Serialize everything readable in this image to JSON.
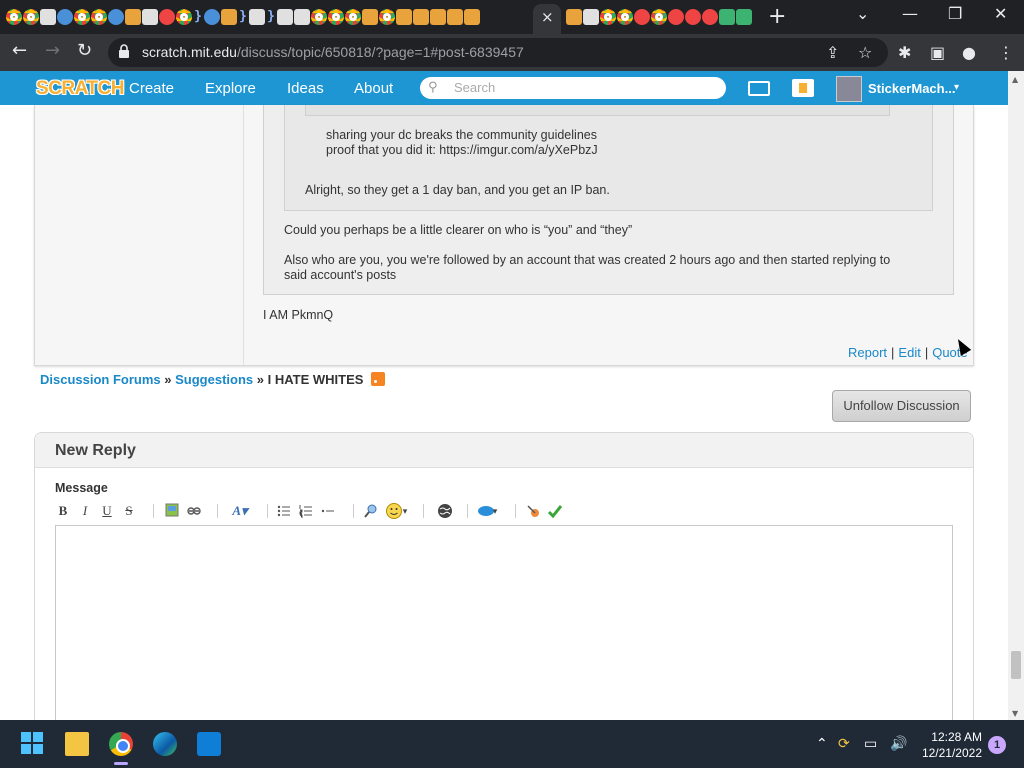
{
  "browser": {
    "active_tab_close": "×",
    "new_tab": "+",
    "window_controls": {
      "tabsearch": "⌄",
      "minimize": "—",
      "restore": "❐",
      "close": "✕"
    },
    "url_host": "scratch.mit.edu",
    "url_path": "/discuss/topic/650818/?page=1#post-6839457",
    "nav": {
      "back": "←",
      "forward": "→",
      "reload": "↻"
    },
    "toolbar_icons": {
      "share": "⇪",
      "bookmark": "☆",
      "extensions": "✱",
      "sidepanel": "▣",
      "profile": "●",
      "menu": "⋮"
    }
  },
  "scratch_nav": {
    "logo": "SCRATCH",
    "links": [
      "Create",
      "Explore",
      "Ideas",
      "About"
    ],
    "search_placeholder": "Search",
    "username": "StickerMach...",
    "caret": "▾"
  },
  "post": {
    "quote_inner_lines": [
      "sharing your dc breaks the community guidelines",
      "proof that you did it: https://imgur.com/a/yXePbzJ"
    ],
    "quote_mid_text": "Alright, so they get a 1 day ban, and you get an IP ban.",
    "quote_outer_line1": "Could you perhaps be a little clearer on who is “you” and “they”",
    "quote_outer_line2a": "Also who are you, you we're followed by an account that was created 2 hours ago and then started replying to",
    "quote_outer_line2b": "said account's posts",
    "body": "I AM PkmnQ",
    "links": {
      "report": "Report",
      "edit": "Edit",
      "quote": "Quote"
    },
    "sep": "|"
  },
  "breadcrumb": {
    "forums": "Discussion Forums",
    "sep": "»",
    "category": "Suggestions",
    "topic": "I HATE WHITES"
  },
  "unfollow_button": "Unfollow Discussion",
  "reply": {
    "title": "New Reply",
    "message_label": "Message",
    "toolbar": {
      "bold": "B",
      "italic": "I",
      "underline": "U",
      "strike": "S",
      "font_style": "A▾",
      "emoji_caret": "▾",
      "color_caret": "▾"
    }
  },
  "taskbar": {
    "time": "12:28 AM",
    "date": "12/21/2022",
    "notification_count": "1",
    "tray": {
      "chevron": "⌃",
      "sync": "⟳",
      "display": "▭",
      "volume": "🔊"
    }
  }
}
